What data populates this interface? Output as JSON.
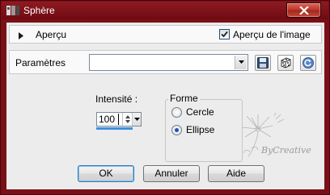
{
  "window": {
    "title": "Sphère"
  },
  "preview": {
    "label": "Aperçu",
    "image_preview_label": "Aperçu de l'image",
    "image_preview_checked": true
  },
  "params": {
    "label": "Paramètres",
    "preset_value": ""
  },
  "intensity": {
    "label": "Intensité :",
    "value": "100"
  },
  "shape": {
    "group_label": "Forme",
    "options": [
      "Cercle",
      "Ellipse"
    ],
    "selected": "Ellipse"
  },
  "watermark": {
    "text": "ByCreative"
  },
  "buttons": {
    "ok": "OK",
    "cancel": "Annuler",
    "help": "Aide"
  },
  "colors": {
    "frame": "#7a0f17",
    "dialog_bg": "#ececec",
    "panel_bg": "#f9f9f9",
    "accent": "#1b53b7",
    "close_button": "#c0392b"
  }
}
